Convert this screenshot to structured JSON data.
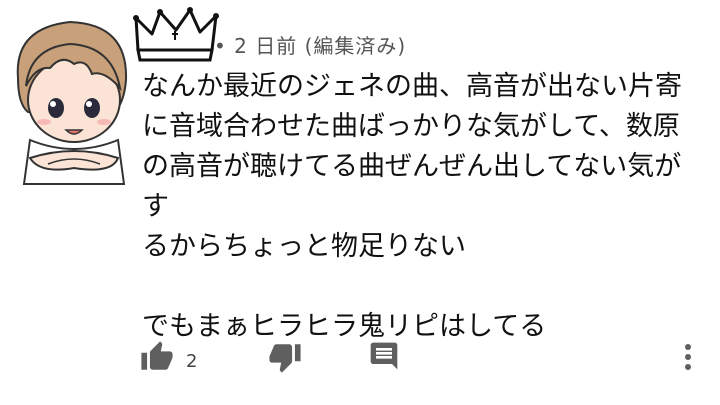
{
  "comment": {
    "meta": "• 2 日前 (編集済み)",
    "lines": [
      "なんか最近のジェネの曲、高音が出ない片寄",
      "に音域合わせた曲ばっかりな気がして、数原",
      "の高音が聴けてる曲ぜんぜん出してない気がす",
      "るからちょっと物足りない"
    ],
    "line2": "でもまぁヒラヒラ鬼リピはしてる",
    "like_count": "2"
  },
  "icons": {
    "crown": "crown-icon",
    "like": "thumbs-up-icon",
    "dislike": "thumbs-down-icon",
    "reply": "reply-icon",
    "more": "more-vertical-icon"
  },
  "colors": {
    "icon_gray": "#5f5f5f",
    "hair": "#c8a07a",
    "text": "#111111"
  }
}
